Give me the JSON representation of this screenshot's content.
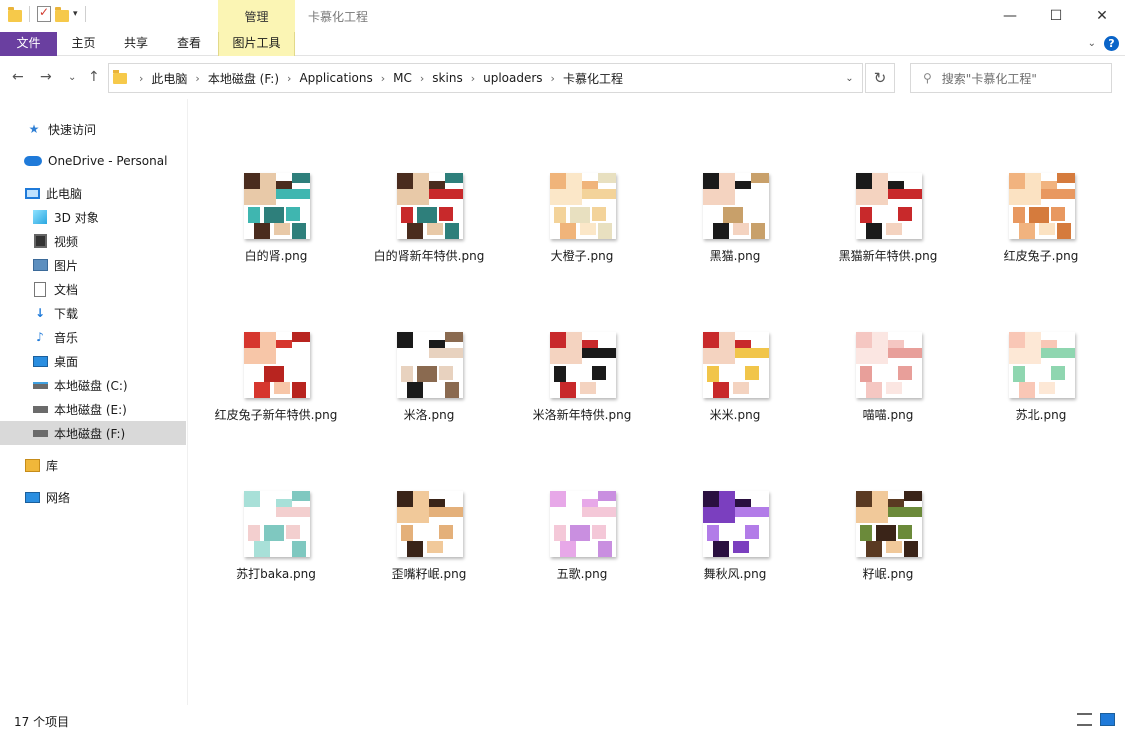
{
  "window": {
    "title": "卡慕化工程",
    "manage_label": "管理"
  },
  "ribbon": {
    "tabs": [
      {
        "label": "文件"
      },
      {
        "label": "主页"
      },
      {
        "label": "共享"
      },
      {
        "label": "查看"
      },
      {
        "label": "图片工具"
      }
    ]
  },
  "address": {
    "crumbs": [
      "此电脑",
      "本地磁盘 (F:)",
      "Applications",
      "MC",
      "skins",
      "uploaders",
      "卡慕化工程"
    ]
  },
  "search": {
    "placeholder": "搜索\"卡慕化工程\""
  },
  "sidebar": {
    "items": [
      {
        "label": "快速访问",
        "icon": "star-icon"
      },
      {
        "label": "OneDrive - Personal",
        "icon": "cloud-icon"
      },
      {
        "label": "此电脑",
        "icon": "computer-icon"
      },
      {
        "label": "3D 对象",
        "icon": "3d-objects-icon"
      },
      {
        "label": "视频",
        "icon": "video-icon"
      },
      {
        "label": "图片",
        "icon": "picture-icon"
      },
      {
        "label": "文档",
        "icon": "document-icon"
      },
      {
        "label": "下载",
        "icon": "download-icon"
      },
      {
        "label": "音乐",
        "icon": "music-icon"
      },
      {
        "label": "桌面",
        "icon": "desktop-icon"
      },
      {
        "label": "本地磁盘 (C:)",
        "icon": "drive-icon"
      },
      {
        "label": "本地磁盘 (E:)",
        "icon": "drive-icon"
      },
      {
        "label": "本地磁盘 (F:)",
        "icon": "drive-icon",
        "selected": true
      },
      {
        "label": "库",
        "icon": "library-icon"
      },
      {
        "label": "网络",
        "icon": "network-icon"
      }
    ]
  },
  "files": [
    {
      "name": "白的肾.png",
      "colors": [
        "#4a2c1e",
        "#e8c9a8",
        "#3fb6b0",
        "#2e7f7b"
      ]
    },
    {
      "name": "白的肾新年特供.png",
      "colors": [
        "#4a2c1e",
        "#e8c9a8",
        "#c8292b",
        "#2e7f7b"
      ]
    },
    {
      "name": "大橙子.png",
      "colors": [
        "#f0b47a",
        "#fbe7c8",
        "#f3d39a",
        "#e8e0c0"
      ]
    },
    {
      "name": "黑猫.png",
      "colors": [
        "#1a1a1a",
        "#f4d3c0",
        "#ffffff",
        "#c8a06a"
      ]
    },
    {
      "name": "黑猫新年特供.png",
      "colors": [
        "#1a1a1a",
        "#f4d3c0",
        "#c8292b",
        "#ffffff"
      ]
    },
    {
      "name": "红皮兔子.png",
      "colors": [
        "#f1b37f",
        "#fbe2c2",
        "#e89860",
        "#d57b3d"
      ]
    },
    {
      "name": "红皮兔子新年特供.png",
      "colors": [
        "#d6362e",
        "#f7c6a8",
        "#ffffff",
        "#b8241f"
      ]
    },
    {
      "name": "米洛.png",
      "colors": [
        "#1a1a1a",
        "#ffffff",
        "#e8d2bf",
        "#8a6a50"
      ]
    },
    {
      "name": "米洛新年特供.png",
      "colors": [
        "#c8292b",
        "#f4d3c0",
        "#1a1a1a",
        "#ffffff"
      ]
    },
    {
      "name": "米米.png",
      "colors": [
        "#c8292b",
        "#f4d3c0",
        "#f1c54a",
        "#ffffff"
      ]
    },
    {
      "name": "喵喵.png",
      "colors": [
        "#f5c7c2",
        "#fbe6e2",
        "#e89f9a",
        "#ffffff"
      ]
    },
    {
      "name": "苏北.png",
      "colors": [
        "#f9c7b6",
        "#fde8d6",
        "#8fd6b0",
        "#ffffff"
      ]
    },
    {
      "name": "苏打baka.png",
      "colors": [
        "#a8e0d8",
        "#ffffff",
        "#f3cfcf",
        "#7fc8c0"
      ]
    },
    {
      "name": "歪嘴籽岷.png",
      "colors": [
        "#3a2418",
        "#f1c99a",
        "#e4b07a",
        "#ffffff"
      ]
    },
    {
      "name": "五歌.png",
      "colors": [
        "#e7a8e8",
        "#ffffff",
        "#f4c8d8",
        "#c98fe0"
      ]
    },
    {
      "name": "舞秋风.png",
      "colors": [
        "#2a1040",
        "#7b3fbf",
        "#b27ce8",
        "#ffffff"
      ]
    },
    {
      "name": "籽岷.png",
      "colors": [
        "#5a3a22",
        "#f1c99a",
        "#6b8a3a",
        "#3a2418"
      ]
    }
  ],
  "status": {
    "count": "17 个项目"
  }
}
